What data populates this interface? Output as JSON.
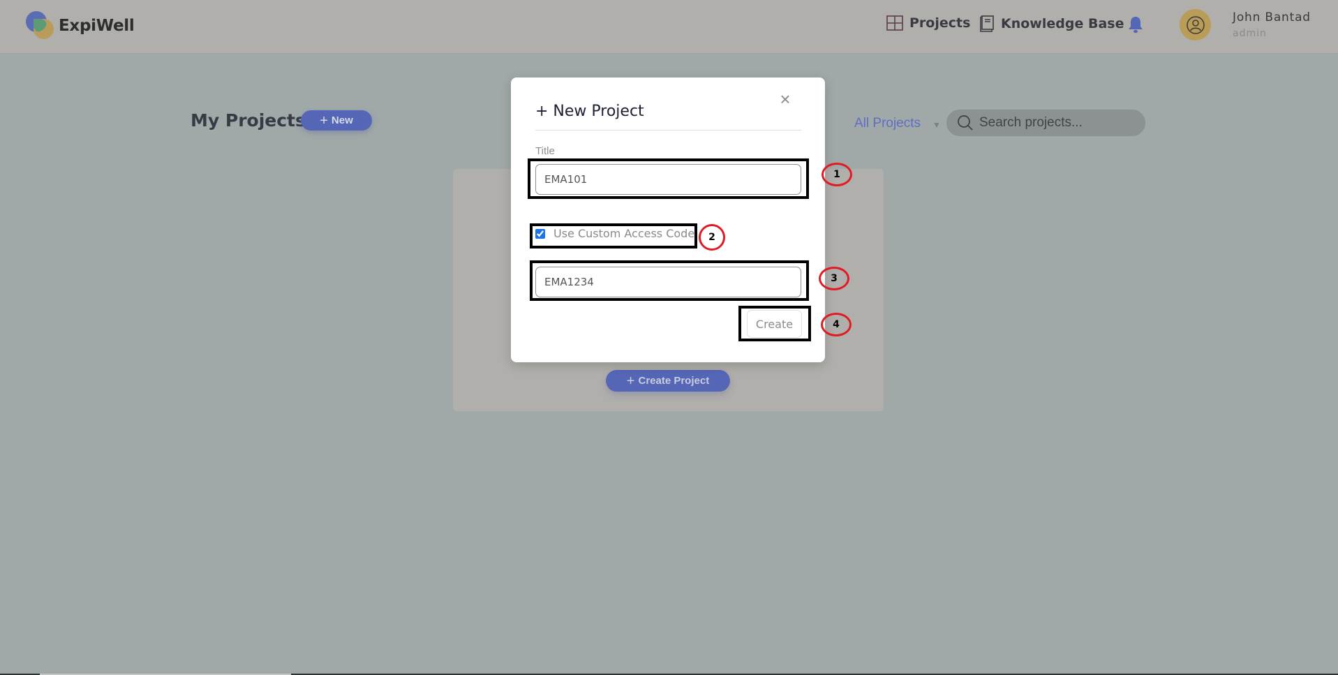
{
  "header": {
    "app_name": "ExpiWell",
    "nav": [
      {
        "label": "Projects",
        "icon": "grid-icon"
      },
      {
        "label": "Knowledge Base",
        "icon": "book-icon"
      }
    ],
    "notification_icon": "bell-icon",
    "user": {
      "name": "John Bantad",
      "role": "admin",
      "avatar_icon": "user-circle-icon"
    }
  },
  "main": {
    "title": "My Projects",
    "new_button_label": "New",
    "filter": {
      "selected": "All Projects"
    },
    "search": {
      "placeholder": "Search projects..."
    },
    "create_project_label": "Create Project"
  },
  "modal": {
    "title": "+ New Project",
    "close_icon": "close-icon",
    "title_label": "Title",
    "title_value": "EMA101",
    "custom_code_label": "Use Custom Access Code",
    "custom_code_checked": true,
    "access_code_value": "EMA1234",
    "create_label": "Create"
  },
  "annotations": [
    "1",
    "2",
    "3",
    "4"
  ],
  "colors": {
    "accent": "#5566b6",
    "overlay": "#a0a9a8",
    "annotation_ring": "#e01b24",
    "checkbox": "#1a73e8"
  }
}
